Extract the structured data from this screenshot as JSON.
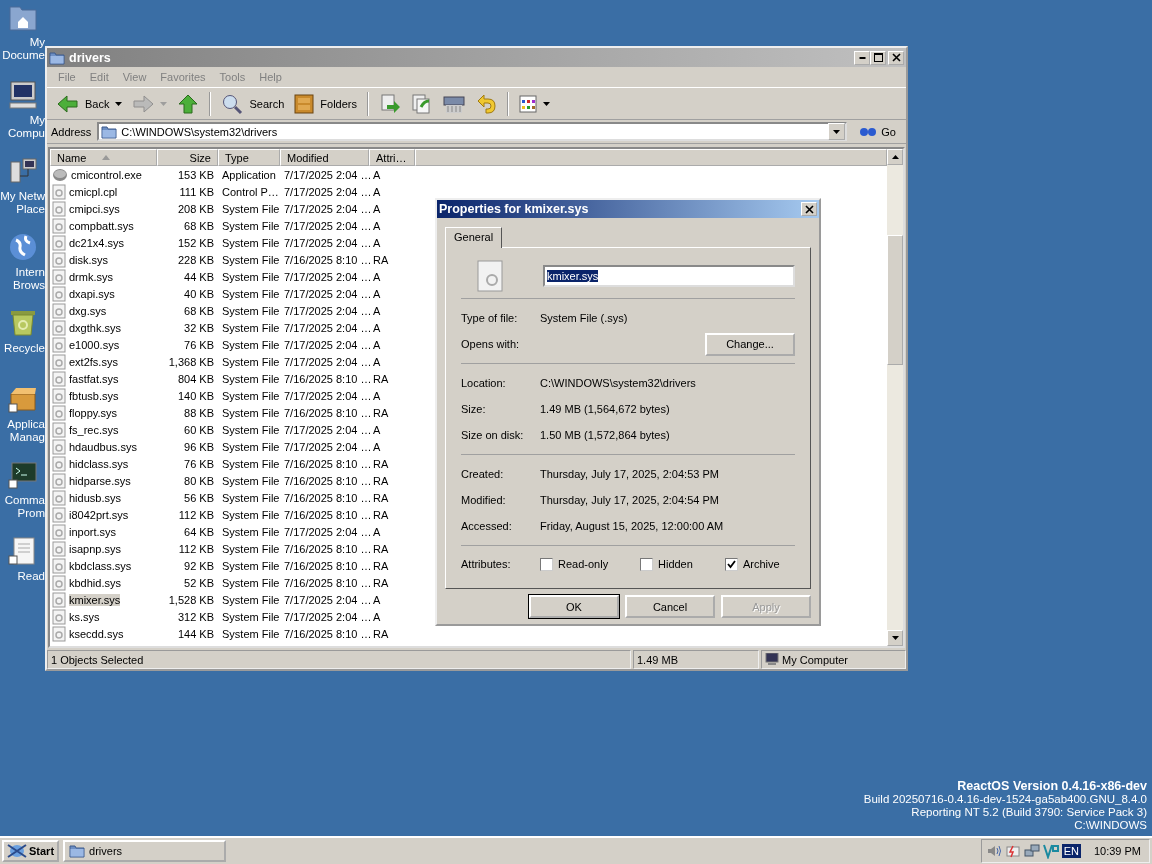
{
  "desktop_icons": [
    {
      "kind": "documents",
      "label_lines": [
        "My",
        "Docume"
      ]
    },
    {
      "kind": "computer",
      "label_lines": [
        "My",
        "Compu"
      ]
    },
    {
      "kind": "network",
      "label_lines": [
        "My Netw",
        "Place"
      ]
    },
    {
      "kind": "internet",
      "label_lines": [
        "Intern",
        "Brows"
      ]
    },
    {
      "kind": "recycle",
      "label_lines": [
        "Recycle"
      ]
    },
    {
      "kind": "applications",
      "label_lines": [
        "Applica",
        "Manag"
      ]
    },
    {
      "kind": "console",
      "label_lines": [
        "Comma",
        "Prom"
      ]
    },
    {
      "kind": "readme",
      "label_lines": [
        "Read"
      ]
    }
  ],
  "explorer": {
    "title": "drivers",
    "active": false,
    "menu": [
      "File",
      "Edit",
      "View",
      "Favorites",
      "Tools",
      "Help"
    ],
    "toolbar": [
      {
        "kind": "back",
        "label": "Back",
        "disabled": false
      },
      {
        "kind": "forward",
        "disabled": true
      },
      {
        "kind": "up",
        "disabled": false
      },
      {
        "kind": "separator"
      },
      {
        "kind": "search",
        "label": "Search",
        "disabled": false
      },
      {
        "kind": "folders",
        "label": "Folders",
        "disabled": false
      },
      {
        "kind": "separator"
      },
      {
        "kind": "move",
        "disabled": false
      },
      {
        "kind": "copy",
        "disabled": false
      },
      {
        "kind": "delete",
        "disabled": false
      },
      {
        "kind": "undo",
        "disabled": false
      },
      {
        "kind": "separator"
      },
      {
        "kind": "views",
        "disabled": false
      }
    ],
    "address": {
      "label": "Address",
      "value": "C:\\WINDOWS\\system32\\drivers",
      "go": "Go"
    },
    "columns": [
      "Name",
      "Size",
      "Type",
      "Modified",
      "Attri…"
    ],
    "rows": [
      {
        "kind": "app",
        "name": "cmicontrol.exe",
        "size": "153 KB",
        "type": "Application",
        "modified": "7/17/2025 2:04 …",
        "attributes": "A",
        "selected": false
      },
      {
        "kind": "file",
        "name": "cmicpl.cpl",
        "size": "111 KB",
        "type": "Control P…",
        "modified": "7/17/2025 2:04 …",
        "attributes": "A",
        "selected": false
      },
      {
        "kind": "file",
        "name": "cmipci.sys",
        "size": "208 KB",
        "type": "System File",
        "modified": "7/17/2025 2:04 …",
        "attributes": "A",
        "selected": false
      },
      {
        "kind": "file",
        "name": "compbatt.sys",
        "size": "68 KB",
        "type": "System File",
        "modified": "7/17/2025 2:04 …",
        "attributes": "A",
        "selected": false
      },
      {
        "kind": "file",
        "name": "dc21x4.sys",
        "size": "152 KB",
        "type": "System File",
        "modified": "7/17/2025 2:04 …",
        "attributes": "A",
        "selected": false
      },
      {
        "kind": "file",
        "name": "disk.sys",
        "size": "228 KB",
        "type": "System File",
        "modified": "7/16/2025 8:10 …",
        "attributes": "RA",
        "selected": false
      },
      {
        "kind": "file",
        "name": "drmk.sys",
        "size": "44 KB",
        "type": "System File",
        "modified": "7/17/2025 2:04 …",
        "attributes": "A",
        "selected": false
      },
      {
        "kind": "file",
        "name": "dxapi.sys",
        "size": "40 KB",
        "type": "System File",
        "modified": "7/17/2025 2:04 …",
        "attributes": "A",
        "selected": false
      },
      {
        "kind": "file",
        "name": "dxg.sys",
        "size": "68 KB",
        "type": "System File",
        "modified": "7/17/2025 2:04 …",
        "attributes": "A",
        "selected": false
      },
      {
        "kind": "file",
        "name": "dxgthk.sys",
        "size": "32 KB",
        "type": "System File",
        "modified": "7/17/2025 2:04 …",
        "attributes": "A",
        "selected": false
      },
      {
        "kind": "file",
        "name": "e1000.sys",
        "size": "76 KB",
        "type": "System File",
        "modified": "7/17/2025 2:04 …",
        "attributes": "A",
        "selected": false
      },
      {
        "kind": "file",
        "name": "ext2fs.sys",
        "size": "1,368 KB",
        "type": "System File",
        "modified": "7/17/2025 2:04 …",
        "attributes": "A",
        "selected": false
      },
      {
        "kind": "file",
        "name": "fastfat.sys",
        "size": "804 KB",
        "type": "System File",
        "modified": "7/16/2025 8:10 …",
        "attributes": "RA",
        "selected": false
      },
      {
        "kind": "file",
        "name": "fbtusb.sys",
        "size": "140 KB",
        "type": "System File",
        "modified": "7/17/2025 2:04 …",
        "attributes": "A",
        "selected": false
      },
      {
        "kind": "file",
        "name": "floppy.sys",
        "size": "88 KB",
        "type": "System File",
        "modified": "7/16/2025 8:10 …",
        "attributes": "RA",
        "selected": false
      },
      {
        "kind": "file",
        "name": "fs_rec.sys",
        "size": "60 KB",
        "type": "System File",
        "modified": "7/17/2025 2:04 …",
        "attributes": "A",
        "selected": false
      },
      {
        "kind": "file",
        "name": "hdaudbus.sys",
        "size": "96 KB",
        "type": "System File",
        "modified": "7/17/2025 2:04 …",
        "attributes": "A",
        "selected": false
      },
      {
        "kind": "file",
        "name": "hidclass.sys",
        "size": "76 KB",
        "type": "System File",
        "modified": "7/16/2025 8:10 …",
        "attributes": "RA",
        "selected": false
      },
      {
        "kind": "file",
        "name": "hidparse.sys",
        "size": "80 KB",
        "type": "System File",
        "modified": "7/16/2025 8:10 …",
        "attributes": "RA",
        "selected": false
      },
      {
        "kind": "file",
        "name": "hidusb.sys",
        "size": "56 KB",
        "type": "System File",
        "modified": "7/16/2025 8:10 …",
        "attributes": "RA",
        "selected": false
      },
      {
        "kind": "file",
        "name": "i8042prt.sys",
        "size": "112 KB",
        "type": "System File",
        "modified": "7/16/2025 8:10 …",
        "attributes": "RA",
        "selected": false
      },
      {
        "kind": "file",
        "name": "inport.sys",
        "size": "64 KB",
        "type": "System File",
        "modified": "7/17/2025 2:04 …",
        "attributes": "A",
        "selected": false
      },
      {
        "kind": "file",
        "name": "isapnp.sys",
        "size": "112 KB",
        "type": "System File",
        "modified": "7/16/2025 8:10 …",
        "attributes": "RA",
        "selected": false
      },
      {
        "kind": "file",
        "name": "kbdclass.sys",
        "size": "92 KB",
        "type": "System File",
        "modified": "7/16/2025 8:10 …",
        "attributes": "RA",
        "selected": false
      },
      {
        "kind": "file",
        "name": "kbdhid.sys",
        "size": "52 KB",
        "type": "System File",
        "modified": "7/16/2025 8:10 …",
        "attributes": "RA",
        "selected": false
      },
      {
        "kind": "file",
        "name": "kmixer.sys",
        "size": "1,528 KB",
        "type": "System File",
        "modified": "7/17/2025 2:04 …",
        "attributes": "A",
        "selected": true
      },
      {
        "kind": "file",
        "name": "ks.sys",
        "size": "312 KB",
        "type": "System File",
        "modified": "7/17/2025 2:04 …",
        "attributes": "A",
        "selected": false
      },
      {
        "kind": "file",
        "name": "ksecdd.sys",
        "size": "144 KB",
        "type": "System File",
        "modified": "7/16/2025 8:10 …",
        "attributes": "RA",
        "selected": false
      }
    ],
    "status_bar": [
      "1 Objects Selected",
      "1.49 MB",
      "My Computer"
    ]
  },
  "dialog": {
    "title": "Properties for kmixer.sys",
    "active": true,
    "tabs": [
      {
        "label": "General",
        "selected": true
      }
    ],
    "file_name": "kmixer.sys",
    "sections": [
      [
        {
          "label": "Type of file:",
          "value": "System File (.sys)"
        },
        {
          "label": "Opens with:",
          "button": "Change..."
        }
      ],
      [
        {
          "label": "Location:",
          "value": "C:\\WINDOWS\\system32\\drivers"
        },
        {
          "label": "Size:",
          "value": "1.49 MB (1,564,672 bytes)"
        },
        {
          "label": "Size on disk:",
          "value": "1.50 MB (1,572,864 bytes)"
        }
      ],
      [
        {
          "label": "Created:",
          "value": "Thursday, July 17, 2025, 2:04:53 PM"
        },
        {
          "label": "Modified:",
          "value": "Thursday, July 17, 2025, 2:04:54 PM"
        },
        {
          "label": "Accessed:",
          "value": "Friday, August 15, 2025, 12:00:00 AM"
        }
      ]
    ],
    "attributes_label": "Attributes:",
    "attributes": [
      {
        "label": "Read-only",
        "checked": false
      },
      {
        "label": "Hidden",
        "checked": false
      },
      {
        "label": "Archive",
        "checked": true
      }
    ],
    "buttons": [
      {
        "label": "OK",
        "disabled": false
      },
      {
        "label": "Cancel",
        "disabled": false
      },
      {
        "label": "Apply",
        "disabled": true
      }
    ]
  },
  "version_info": [
    "ReactOS Version 0.4.16-x86-dev",
    "Build 20250716-0.4.16-dev-1524-ga5ab400.GNU_8.4.0",
    "Reporting NT 5.2 (Build 3790: Service Pack 3)",
    "C:\\WINDOWS"
  ],
  "taskbar": {
    "start": "Start",
    "tasks": [
      {
        "label": "drivers",
        "selected": false
      }
    ],
    "language": "EN",
    "clock": "10:39 PM"
  }
}
